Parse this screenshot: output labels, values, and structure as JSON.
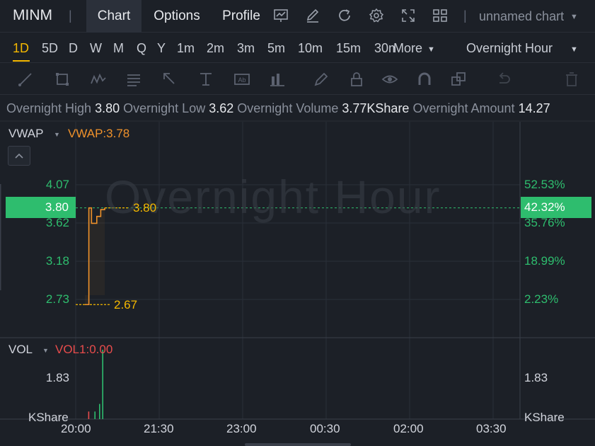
{
  "header": {
    "ticker": "MINM",
    "tabs": [
      {
        "label": "Chart",
        "active": true
      },
      {
        "label": "Options",
        "active": false
      },
      {
        "label": "Profile",
        "active": false
      }
    ],
    "toolbar_icons": [
      "line-chart-icon",
      "edit-icon",
      "refresh-icon",
      "settings-icon",
      "fullscreen-icon",
      "grid-layout-icon"
    ],
    "chart_name": "unnamed chart"
  },
  "periods": {
    "items": [
      "1D",
      "5D",
      "D",
      "W",
      "M",
      "Q",
      "Y",
      "1m",
      "2m",
      "3m",
      "5m",
      "10m",
      "15m",
      "30m"
    ],
    "active": "1D",
    "more_label": "More",
    "session": "Overnight Hour"
  },
  "drawing_tools": [
    "trendline-icon",
    "rectangle-icon",
    "pattern-icon",
    "fibonacci-icon",
    "arrow-icon",
    "text-cursor-icon",
    "text-box-icon",
    "measure-icon",
    "brush-icon",
    "lock-icon",
    "eye-icon",
    "magnet-icon",
    "layers-icon",
    "undo-icon",
    "trash-icon"
  ],
  "info": {
    "high_label": "Overnight High",
    "high": "3.80",
    "low_label": "Overnight Low",
    "low": "3.62",
    "volume_label": "Overnight Volume",
    "volume": "3.77KShare",
    "amount_label": "Overnight Amount",
    "amount": "14.27"
  },
  "main_pane": {
    "indicator": "VWAP",
    "indicator_value": "VWAP:3.78",
    "watermark": "Overnight Hour",
    "left_axis": [
      "4.07",
      "3.62",
      "3.18",
      "2.73"
    ],
    "right_axis": [
      "52.53%",
      "35.76%",
      "18.99%",
      "2.23%"
    ],
    "current_price": "3.80",
    "current_pct": "42.32%",
    "high_marker": "3.80",
    "low_marker": "2.67"
  },
  "volume_pane": {
    "indicator": "VOL",
    "indicator_value": "VOL1:0.00",
    "left_axis": "1.83",
    "right_axis": "1.83",
    "left_unit": "KShare",
    "right_unit": "KShare"
  },
  "time_axis": [
    "20:00",
    "21:30",
    "23:00",
    "00:30",
    "02:00",
    "03:30"
  ],
  "colors": {
    "up": "#2ebd6e",
    "down": "#e84c4c",
    "accent": "#f5b800",
    "vwap": "#f0922b"
  },
  "chart_data": {
    "type": "line",
    "x": [
      "20:00",
      "20:02",
      "20:04",
      "20:06",
      "20:08",
      "20:10",
      "20:12",
      "20:14",
      "20:16",
      "20:18",
      "20:20",
      "20:22",
      "20:24",
      "20:26",
      "20:28",
      "20:30"
    ],
    "series": [
      {
        "name": "VWAP",
        "values": [
          2.67,
          2.67,
          2.67,
          3.8,
          3.8,
          3.62,
          3.62,
          3.62,
          3.62,
          3.7,
          3.7,
          3.7,
          3.78,
          3.78,
          3.78,
          3.8
        ]
      }
    ],
    "ylim": [
      2.55,
      4.2
    ],
    "volume": {
      "values": [
        0,
        0,
        0,
        0.2,
        0,
        0,
        0,
        0.2,
        0,
        0,
        0.4,
        0,
        1.83,
        0
      ],
      "colors": [
        "up",
        "up",
        "up",
        "down",
        "up",
        "up",
        "up",
        "up",
        "up",
        "up",
        "up",
        "up",
        "up",
        "up"
      ]
    }
  }
}
